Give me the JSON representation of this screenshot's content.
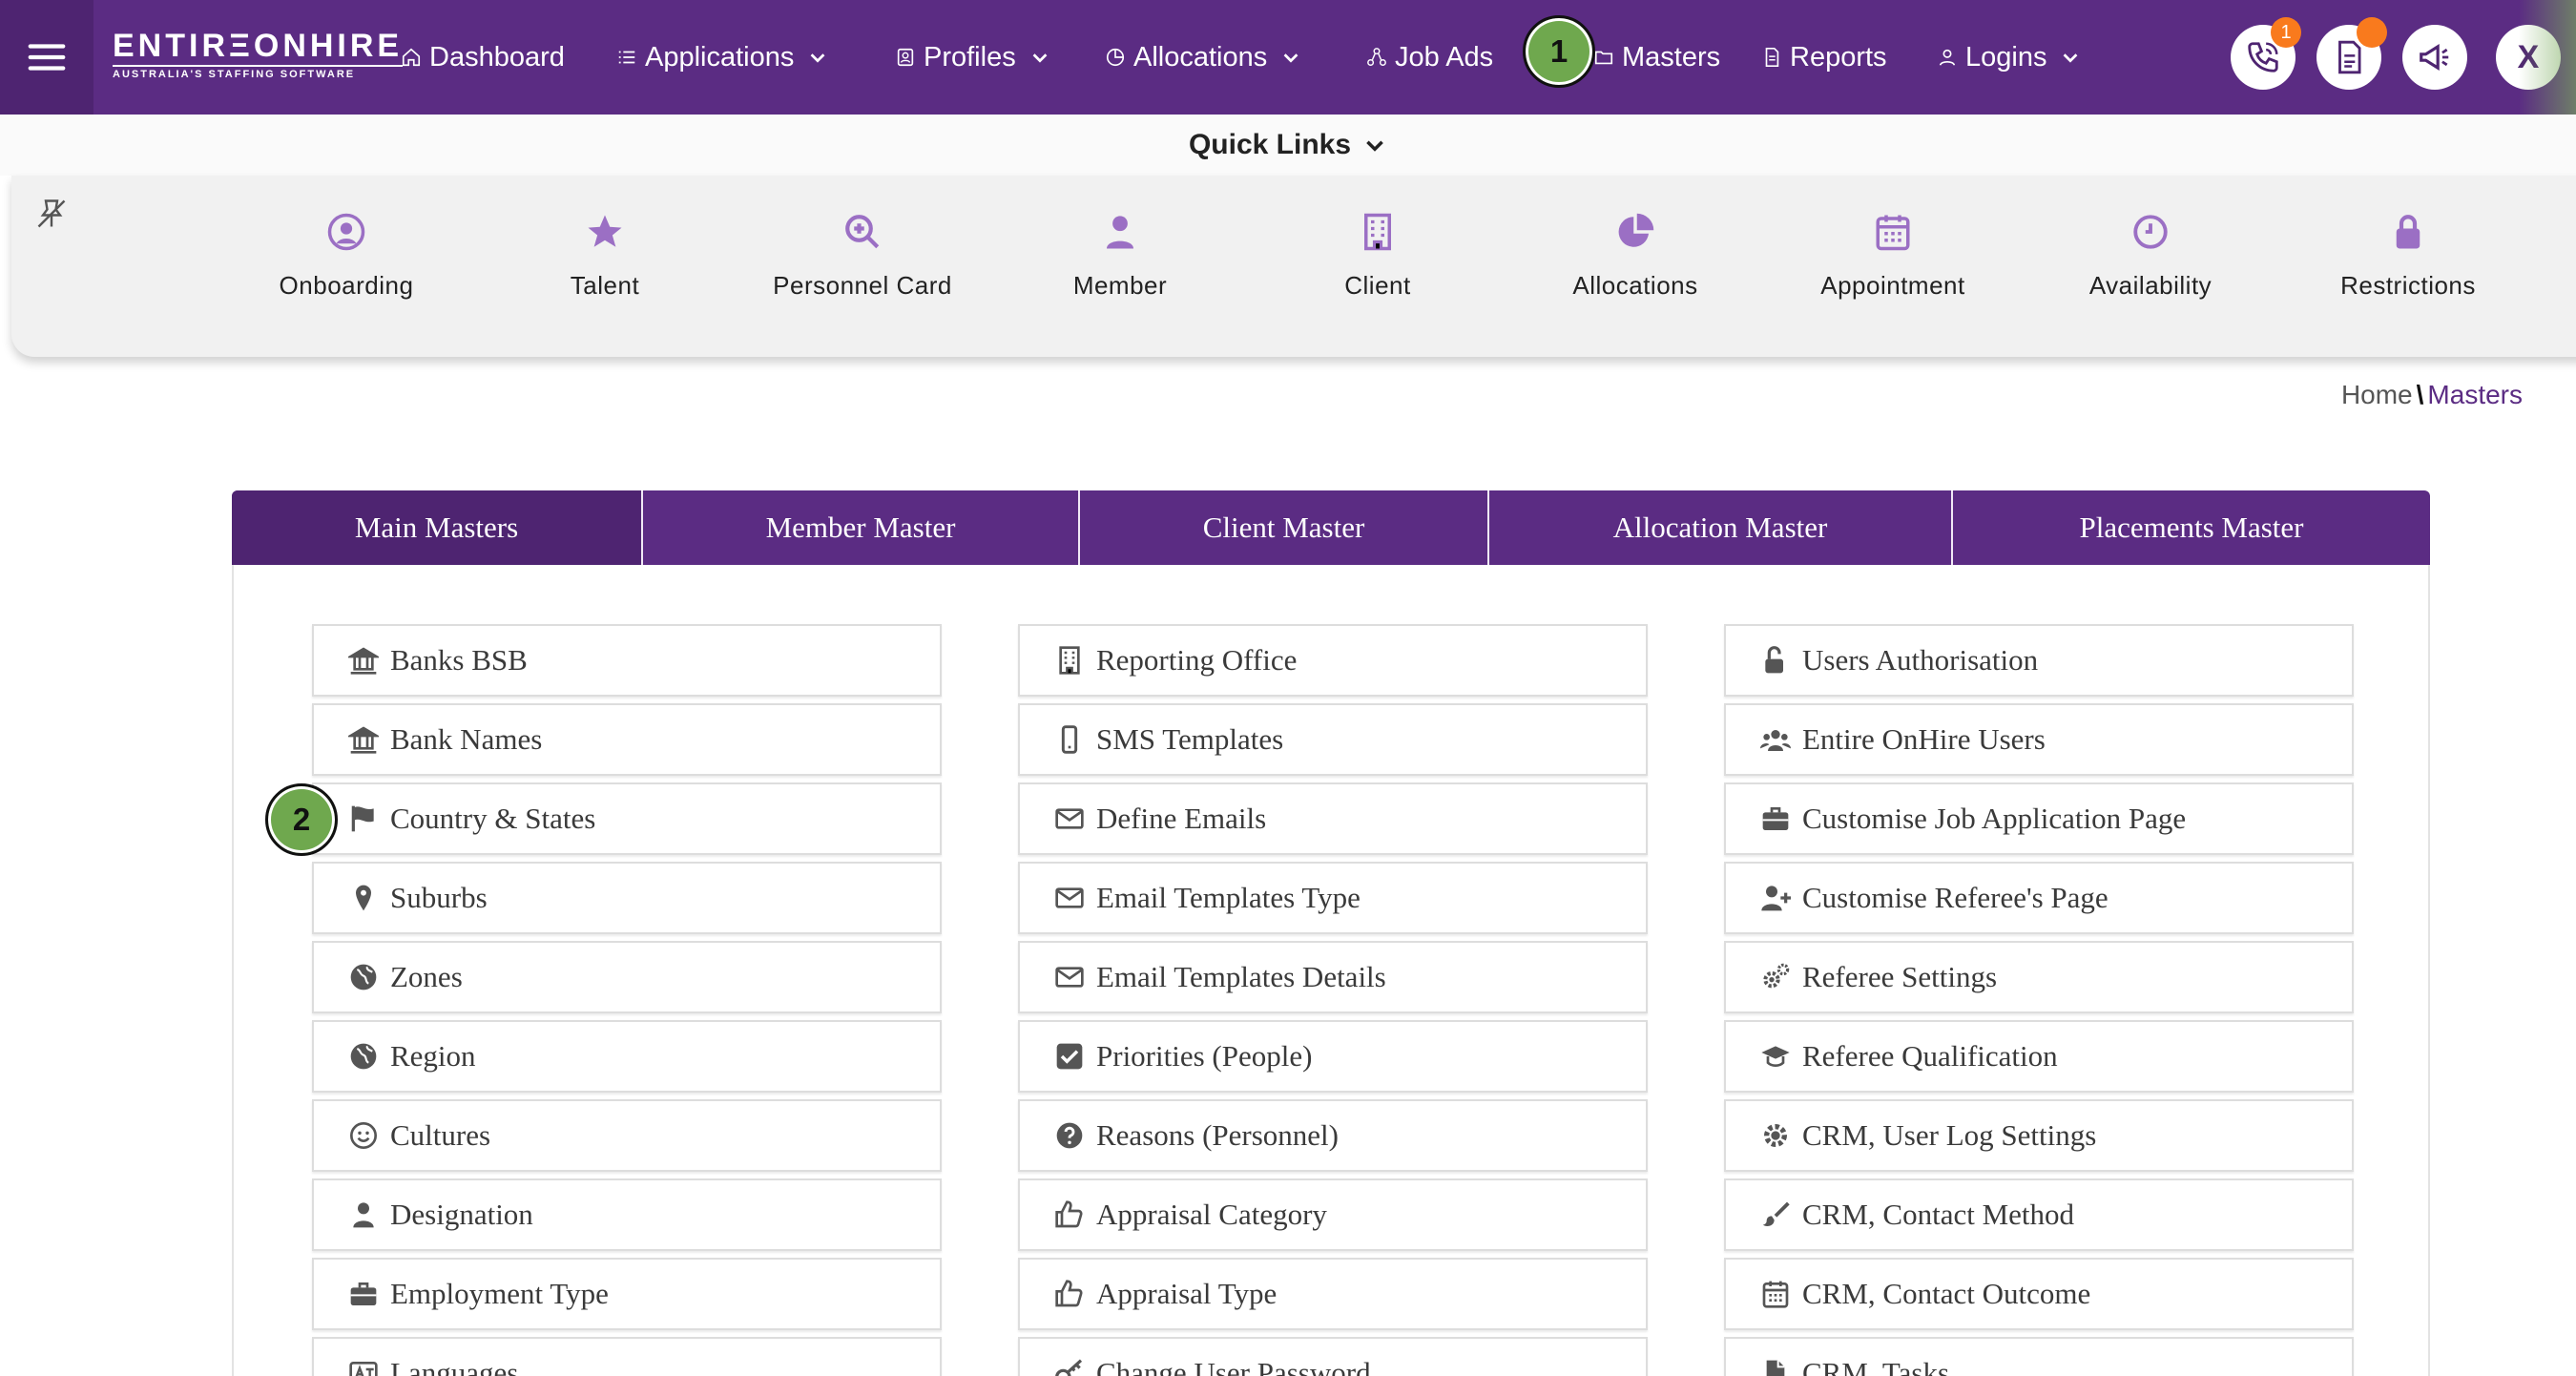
{
  "logo": {
    "main": "ENTIRΞONHIRE",
    "sub": "AUSTRALIA'S STAFFING SOFTWARE"
  },
  "nav": {
    "items": [
      {
        "label": "Dashboard",
        "icon": "home-icon",
        "dropdown": false
      },
      {
        "label": "Applications",
        "icon": "list-icon",
        "dropdown": true
      },
      {
        "label": "Profiles",
        "icon": "id-card-icon",
        "dropdown": true
      },
      {
        "label": "Allocations",
        "icon": "pie-icon",
        "dropdown": true
      },
      {
        "label": "Job Ads",
        "icon": "network-icon",
        "dropdown": false
      },
      {
        "label": "Masters",
        "icon": "folder-icon",
        "dropdown": false
      },
      {
        "label": "Reports",
        "icon": "document-icon",
        "dropdown": false
      },
      {
        "label": "Logins",
        "icon": "user-icon",
        "dropdown": true
      }
    ],
    "call_badge": "1",
    "avatar_letter": "X"
  },
  "steps": [
    "1",
    "2"
  ],
  "quick_links": {
    "title": "Quick Links",
    "items": [
      {
        "label": "Onboarding",
        "icon": "user-circle-icon"
      },
      {
        "label": "Talent",
        "icon": "star-icon"
      },
      {
        "label": "Personnel Card",
        "icon": "search-plus-icon"
      },
      {
        "label": "Member",
        "icon": "person-icon"
      },
      {
        "label": "Client",
        "icon": "building-icon"
      },
      {
        "label": "Allocations",
        "icon": "pie-chart-icon"
      },
      {
        "label": "Appointment",
        "icon": "calendar-icon"
      },
      {
        "label": "Availability",
        "icon": "clock-icon"
      },
      {
        "label": "Restrictions",
        "icon": "lock-icon"
      }
    ]
  },
  "breadcrumb": {
    "home": "Home",
    "separator": "\\",
    "current": "Masters"
  },
  "tabs": [
    "Main Masters",
    "Member Master",
    "Client Master",
    "Allocation Master",
    "Placements Master"
  ],
  "masters": {
    "col1": [
      {
        "label": "Banks BSB",
        "icon": "bank-icon"
      },
      {
        "label": "Bank Names",
        "icon": "bank-icon"
      },
      {
        "label": "Country & States",
        "icon": "flag-icon"
      },
      {
        "label": "Suburbs",
        "icon": "map-marker-icon"
      },
      {
        "label": "Zones",
        "icon": "globe-icon"
      },
      {
        "label": "Region",
        "icon": "globe-icon"
      },
      {
        "label": "Cultures",
        "icon": "smile-icon"
      },
      {
        "label": "Designation",
        "icon": "person-icon"
      },
      {
        "label": "Employment Type",
        "icon": "briefcase-icon"
      },
      {
        "label": "Languages",
        "icon": "language-icon"
      }
    ],
    "col2": [
      {
        "label": "Reporting Office",
        "icon": "building-icon"
      },
      {
        "label": "SMS Templates",
        "icon": "mobile-icon"
      },
      {
        "label": "Define Emails",
        "icon": "envelope-icon"
      },
      {
        "label": "Email Templates Type",
        "icon": "envelope-icon"
      },
      {
        "label": "Email Templates Details",
        "icon": "envelope-icon"
      },
      {
        "label": "Priorities (People)",
        "icon": "check-square-icon"
      },
      {
        "label": "Reasons (Personnel)",
        "icon": "question-circle-icon"
      },
      {
        "label": "Appraisal Category",
        "icon": "thumbs-up-icon"
      },
      {
        "label": "Appraisal Type",
        "icon": "thumbs-up-icon"
      },
      {
        "label": "Change User Password",
        "icon": "key-icon"
      }
    ],
    "col3": [
      {
        "label": "Users Authorisation",
        "icon": "unlock-icon"
      },
      {
        "label": "Entire OnHire Users",
        "icon": "users-icon"
      },
      {
        "label": "Customise Job Application Page",
        "icon": "briefcase-icon"
      },
      {
        "label": "Customise Referee's Page",
        "icon": "user-plus-icon"
      },
      {
        "label": "Referee Settings",
        "icon": "cogs-icon"
      },
      {
        "label": "Referee Qualification",
        "icon": "graduation-cap-icon"
      },
      {
        "label": "CRM, User Log Settings",
        "icon": "gear-icon"
      },
      {
        "label": "CRM, Contact Method",
        "icon": "paint-brush-icon"
      },
      {
        "label": "CRM, Contact Outcome",
        "icon": "calendar-icon"
      },
      {
        "label": "CRM, Tasks",
        "icon": "file-icon"
      }
    ]
  }
}
